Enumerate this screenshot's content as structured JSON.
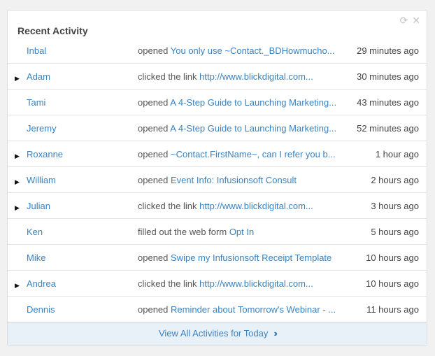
{
  "widget": {
    "title": "Recent Activity",
    "refresh_icon": "refresh-icon",
    "close_icon": "close-icon",
    "footer_link": "View All Activities for Today",
    "footer_icon": "double-chevron-right-icon"
  },
  "activities": [
    {
      "name": "Inbal",
      "expand": false,
      "verb": "opened",
      "target": "You only use ~Contact._BDHowmucho...",
      "time": "29 minutes ago"
    },
    {
      "name": "Adam",
      "expand": true,
      "verb": "clicked the link",
      "target": "http://www.blickdigital.com...",
      "time": "30 minutes ago"
    },
    {
      "name": "Tami",
      "expand": false,
      "verb": "opened",
      "target": "A 4-Step Guide to Launching Marketing...",
      "time": "43 minutes ago"
    },
    {
      "name": "Jeremy",
      "expand": false,
      "verb": "opened",
      "target": "A 4-Step Guide to Launching Marketing...",
      "time": "52 minutes ago"
    },
    {
      "name": "Roxanne",
      "expand": true,
      "verb": "opened",
      "target": "~Contact.FirstName~, can I refer you b...",
      "time": "1 hour ago"
    },
    {
      "name": "William",
      "expand": true,
      "verb": "opened",
      "target": "Event Info: Infusionsoft Consult",
      "time": "2 hours ago"
    },
    {
      "name": "Julian",
      "expand": true,
      "verb": "clicked the link",
      "target": "http://www.blickdigital.com...",
      "time": "3 hours ago"
    },
    {
      "name": "Ken",
      "expand": false,
      "verb": "filled out the web form",
      "target": "Opt In",
      "time": "5 hours ago"
    },
    {
      "name": "Mike",
      "expand": false,
      "verb": "opened",
      "target": "Swipe my Infusionsoft Receipt Template",
      "time": "10 hours ago"
    },
    {
      "name": "Andrea",
      "expand": true,
      "verb": "clicked the link",
      "target": "http://www.blickdigital.com...",
      "time": "10 hours ago"
    },
    {
      "name": "Dennis",
      "expand": false,
      "verb": "opened",
      "target": "Reminder about Tomorrow's Webinar - ...",
      "time": "11 hours ago"
    }
  ]
}
